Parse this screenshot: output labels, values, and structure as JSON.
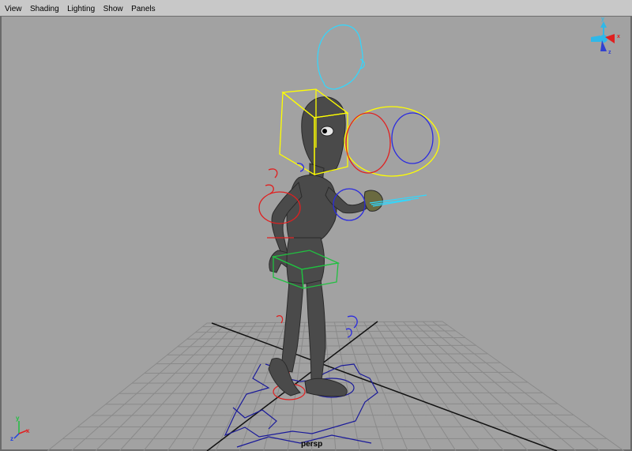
{
  "menubar": {
    "items": [
      {
        "label": "View"
      },
      {
        "label": "Shading"
      },
      {
        "label": "Lighting"
      },
      {
        "label": "Show"
      },
      {
        "label": "Panels"
      }
    ]
  },
  "viewport": {
    "camera_name": "persp",
    "background_color": "#a2a2a2",
    "grid_color": "#8a8a8a",
    "axis_labels": {
      "x": "x",
      "y": "y",
      "z": "z"
    },
    "view_cube_labels": {
      "top": "y",
      "right": "x",
      "front": "z"
    },
    "controls": {
      "head_control_color": "#ffff00",
      "left_color": "#ff2020",
      "right_color": "#2020ff",
      "extra_color": "#30e0ff",
      "hip_color": "#20c040"
    }
  }
}
